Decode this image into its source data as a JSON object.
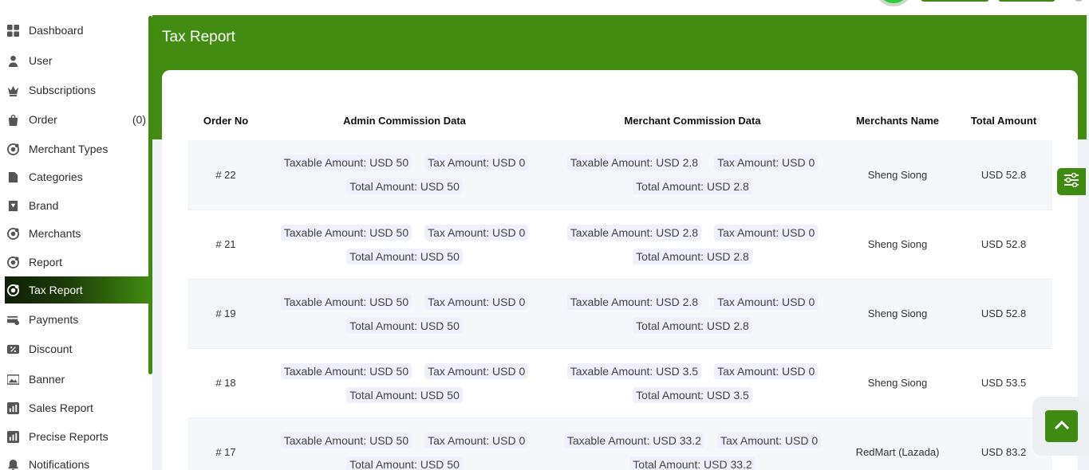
{
  "sidebar": {
    "items": [
      {
        "label": "Dashboard",
        "icon": "dashboard-grid-icon"
      },
      {
        "label": "User",
        "icon": "user-icon"
      },
      {
        "label": "Subscriptions",
        "icon": "crown-icon"
      },
      {
        "label": "Order",
        "icon": "bag-icon",
        "count": "(0)"
      },
      {
        "label": "Merchant Types",
        "icon": "merchant-icon"
      },
      {
        "label": "Categories",
        "icon": "categories-icon"
      },
      {
        "label": "Brand",
        "icon": "brand-icon"
      },
      {
        "label": "Merchants",
        "icon": "merchants-icon"
      },
      {
        "label": "Report",
        "icon": "report-icon"
      },
      {
        "label": "Tax Report",
        "icon": "tax-report-icon",
        "active": true
      },
      {
        "label": "Payments",
        "icon": "payments-icon"
      },
      {
        "label": "Discount",
        "icon": "discount-icon"
      },
      {
        "label": "Banner",
        "icon": "banner-icon"
      },
      {
        "label": "Sales Report",
        "icon": "sales-report-icon"
      },
      {
        "label": "Precise Reports",
        "icon": "precise-reports-icon"
      },
      {
        "label": "Notifications",
        "icon": "bell-icon"
      }
    ]
  },
  "page": {
    "title": "Tax Report"
  },
  "table": {
    "headers": [
      "Order No",
      "Admin Commission Data",
      "Merchant Commission Data",
      "Merchants Name",
      "Total Amount"
    ],
    "rows": [
      {
        "order_no": "# 22",
        "admin": {
          "taxable": "Taxable Amount: USD 50",
          "tax": "Tax Amount: USD 0",
          "total": "Total Amount: USD 50"
        },
        "merchant": {
          "taxable": "Taxable Amount: USD 2.8",
          "tax": "Tax Amount: USD 0",
          "total": "Total Amount: USD 2.8"
        },
        "merchant_name": "Sheng Siong",
        "total_amount": "USD 52.8"
      },
      {
        "order_no": "# 21",
        "admin": {
          "taxable": "Taxable Amount: USD 50",
          "tax": "Tax Amount: USD 0",
          "total": "Total Amount: USD 50"
        },
        "merchant": {
          "taxable": "Taxable Amount: USD 2.8",
          "tax": "Tax Amount: USD 0",
          "total": "Total Amount: USD 2.8"
        },
        "merchant_name": "Sheng Siong",
        "total_amount": "USD 52.8"
      },
      {
        "order_no": "# 19",
        "admin": {
          "taxable": "Taxable Amount: USD 50",
          "tax": "Tax Amount: USD 0",
          "total": "Total Amount: USD 50"
        },
        "merchant": {
          "taxable": "Taxable Amount: USD 2.8",
          "tax": "Tax Amount: USD 0",
          "total": "Total Amount: USD 2.8"
        },
        "merchant_name": "Sheng Siong",
        "total_amount": "USD 52.8"
      },
      {
        "order_no": "# 18",
        "admin": {
          "taxable": "Taxable Amount: USD 50",
          "tax": "Tax Amount: USD 0",
          "total": "Total Amount: USD 50"
        },
        "merchant": {
          "taxable": "Taxable Amount: USD 3.5",
          "tax": "Tax Amount: USD 0",
          "total": "Total Amount: USD 3.5"
        },
        "merchant_name": "Sheng Siong",
        "total_amount": "USD 53.5"
      },
      {
        "order_no": "# 17",
        "admin": {
          "taxable": "Taxable Amount: USD 50",
          "tax": "Tax Amount: USD 0",
          "total": "Total Amount: USD 50"
        },
        "merchant": {
          "taxable": "Taxable Amount: USD 33.2",
          "tax": "Tax Amount: USD 0",
          "total": "Total Amount: USD 33.2"
        },
        "merchant_name": "RedMart (Lazada)",
        "total_amount": "USD 83.2"
      }
    ]
  },
  "floating": {
    "settings_icon": "sliders-icon",
    "scroll_top_icon": "chevron-up-icon"
  },
  "colors": {
    "brand_green": "#438c12",
    "active_dark": "#0d1f05",
    "chip_bg": "#eff0fb"
  }
}
